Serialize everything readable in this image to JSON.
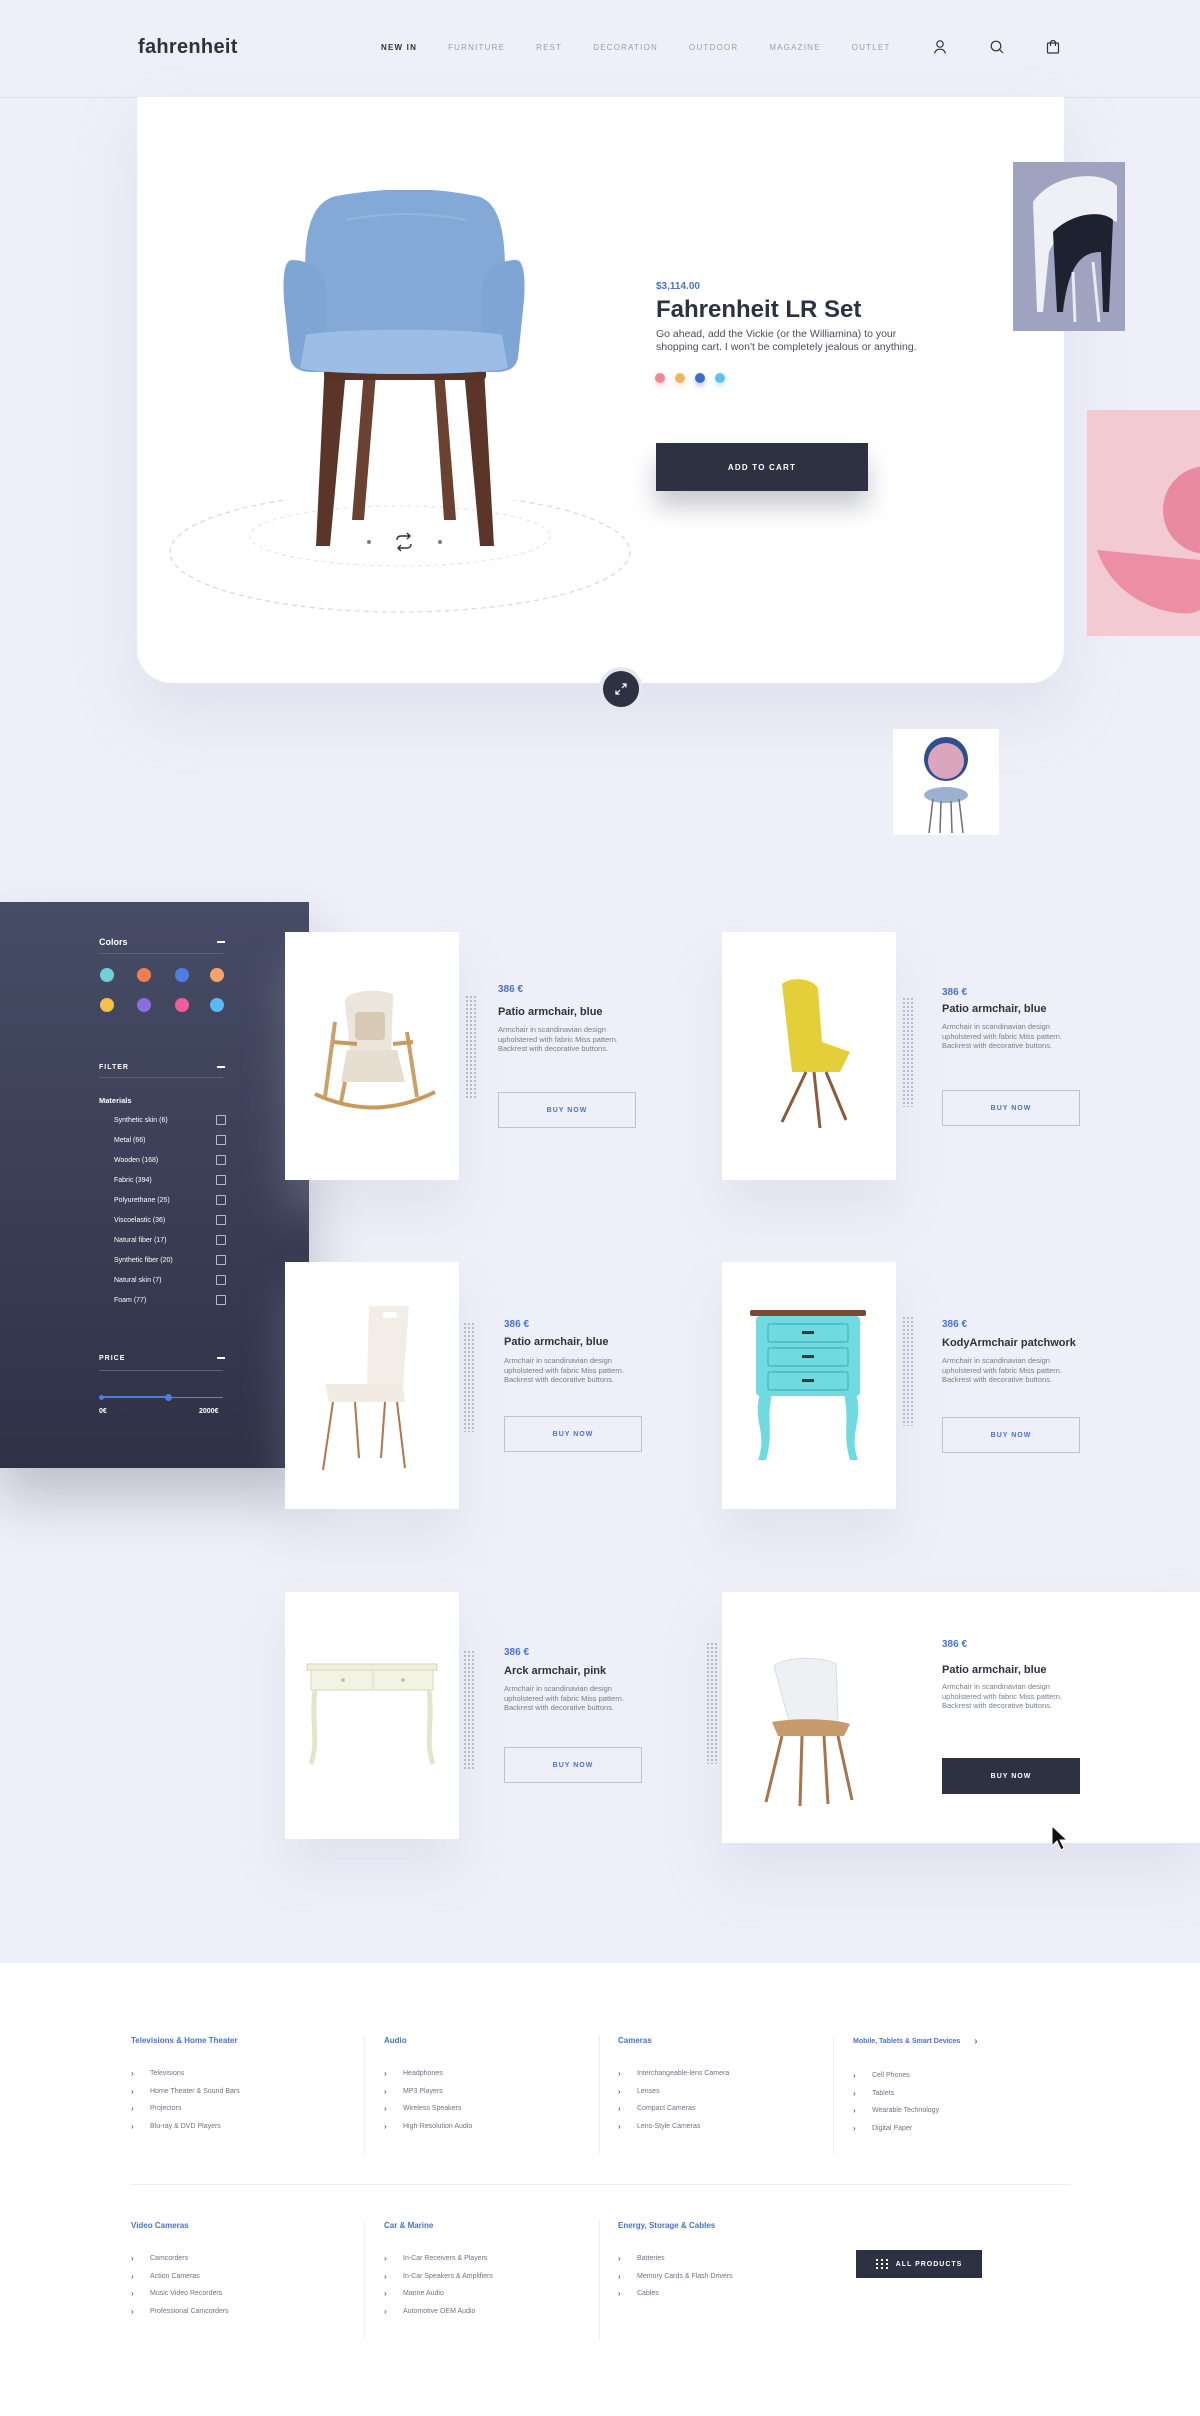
{
  "header": {
    "logo": "fahrenheit",
    "nav": [
      "NEW IN",
      "FURNITURE",
      "REST",
      "DECORATION",
      "OUTDOOR",
      "MAGAZINE",
      "OUTLET"
    ],
    "icons": [
      "user-icon",
      "search-icon",
      "cart-icon"
    ]
  },
  "hero": {
    "price": "$3,114.00",
    "title": "Fahrenheit LR Set",
    "description": "Go ahead, add the Vickie (or the Williamina) to your shopping cart. I won't be completely jealous or anything.",
    "swatches": [
      "#f2878f",
      "#f0b763",
      "#3f6cc5",
      "#5ec3ea"
    ],
    "add_to_cart": "ADD TO CART"
  },
  "sidebar": {
    "colors_title": "Colors",
    "colors": [
      "#6fd0d6",
      "#f27d4e",
      "#4d7fde",
      "#f5a36a",
      "#f5c04a",
      "#8a6de0",
      "#f25c9b",
      "#5ab8f2"
    ],
    "filter_title": "FILTER",
    "materials_title": "Materials",
    "materials": [
      "Synthetic skin (6)",
      "Metal (66)",
      "Wooden (168)",
      "Fabric (394)",
      "Polyurethane (25)",
      "Viscoelastic (36)",
      "Natural fiber (17)",
      "Synthetic fiber (20)",
      "Natural skin (7)",
      "Foam (77)"
    ],
    "price_title": "PRICE",
    "price_min": "0€",
    "price_max": "2000€",
    "price_level": 0.55
  },
  "products": [
    {
      "price": "386 €",
      "name": "Patio armchair, blue",
      "desc": "Armchair in scandinavian design upholstered with fabric Miss pattern. Backrest with decorative buttons.",
      "button": "BUY NOW"
    },
    {
      "price": "386 €",
      "name": "Patio armchair, blue",
      "desc": "Armchair in scandinavian design upholstered with fabric Miss pattern. Backrest with decorative buttons.",
      "button": "BUY NOW"
    },
    {
      "price": "386 €",
      "name": "Patio armchair, blue",
      "desc": "Armchair in scandinavian design upholstered with fabric Miss pattern. Backrest with decorative buttons.",
      "button": "BUY NOW"
    },
    {
      "price": "386 €",
      "name": "KodyArmchair patchwork",
      "desc": "Armchair in scandinavian design upholstered with fabric Miss pattern. Backrest with decorative buttons.",
      "button": "BUY NOW"
    },
    {
      "price": "386 €",
      "name": "Arck armchair, pink",
      "desc": "Armchair in scandinavian design upholstered with fabric Miss pattern. Backrest with decorative buttons.",
      "button": "BUY NOW"
    },
    {
      "price": "386 €",
      "name": "Patio armchair, blue",
      "desc": "Armchair in scandinavian design upholstered with fabric Miss pattern. Backrest with decorative buttons.",
      "button": "BUY NOW"
    }
  ],
  "footer": {
    "columns": [
      {
        "title": "Televisions & Home Theater",
        "items": [
          "Televisions",
          "Home Theater & Sound Bars",
          "Projectors",
          "Blu-ray & DVD Players"
        ]
      },
      {
        "title": "Audio",
        "items": [
          "Headphones",
          "MP3 Players",
          "Wireless Speakers",
          "High-Resolution Audio"
        ]
      },
      {
        "title": "Cameras",
        "items": [
          "Interchangeable-lens Camera",
          "Lenses",
          "Compact Cameras",
          "Lens-Style Cameras"
        ]
      },
      {
        "title": "Mobile, Tablets & Smart Devices",
        "items": [
          "Cell Phones",
          "Tablets",
          "Wearable Technology",
          "Digital Paper"
        ]
      },
      {
        "title": "Video Cameras",
        "items": [
          "Camcorders",
          "Action Cameras",
          "Music Video Recorders",
          "Professional Camcorders"
        ]
      },
      {
        "title": "Car & Marine",
        "items": [
          "In-Car Receivers & Players",
          "In-Car Speakers & Amplifiers",
          "Marine Audio",
          "Automotive OEM Audio"
        ]
      },
      {
        "title": "Energy, Storage & Cables",
        "items": [
          "Batteries",
          "Memory Cards & Flash Drivers",
          "Cables"
        ]
      }
    ],
    "all_products": "ALL PRODUCTS"
  }
}
